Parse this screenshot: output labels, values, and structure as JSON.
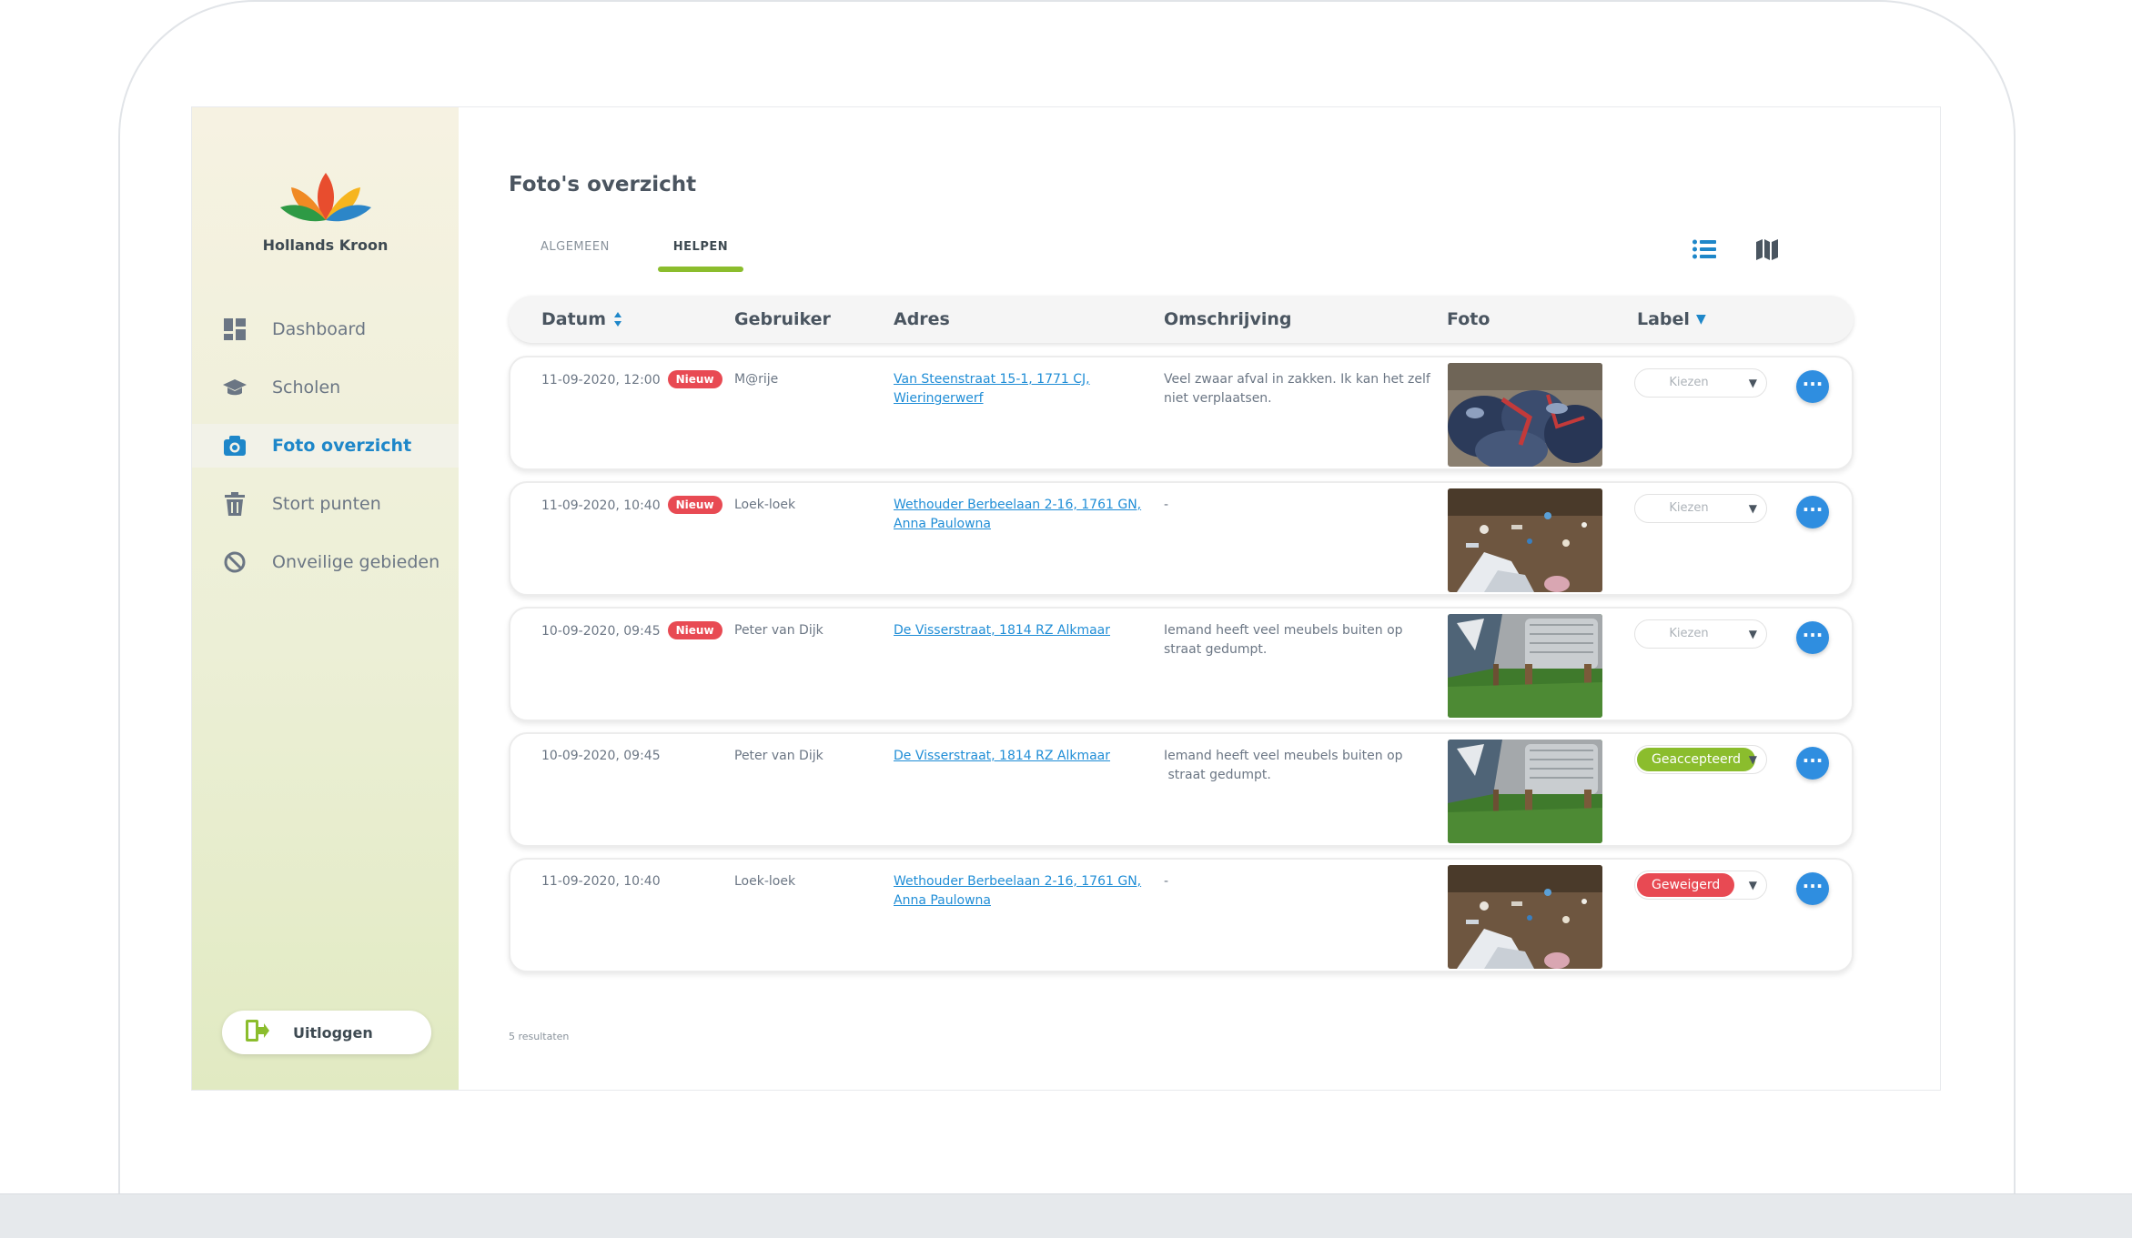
{
  "brand": {
    "name": "Hollands Kroon"
  },
  "sidebar": {
    "items": [
      {
        "label": "Dashboard",
        "icon": "dashboard-icon",
        "active": false
      },
      {
        "label": "Scholen",
        "icon": "graduation-cap-icon",
        "active": false
      },
      {
        "label": "Foto overzicht",
        "icon": "camera-icon",
        "active": true
      },
      {
        "label": "Stort punten",
        "icon": "trash-icon",
        "active": false
      },
      {
        "label": "Onveilige gebieden",
        "icon": "prohibited-icon",
        "active": false
      }
    ],
    "logout_label": "Uitloggen"
  },
  "page": {
    "title": "Foto's overzicht"
  },
  "tabs": [
    {
      "label": "ALGEMEEN",
      "active": false
    },
    {
      "label": "HELPEN",
      "active": true
    }
  ],
  "view_toggle": {
    "list_icon": "list-view-icon",
    "map_icon": "map-view-icon",
    "active": "list"
  },
  "table": {
    "headers": {
      "datum": "Datum",
      "gebruiker": "Gebruiker",
      "adres": "Adres",
      "omschrijving": "Omschrijving",
      "foto": "Foto",
      "label": "Label"
    },
    "rows": [
      {
        "date": "11-09-2020, 12:00",
        "badge": "Nieuw",
        "user": "M@rije",
        "address_line1": "Van Steenstraat 15-1, 1771 CJ,",
        "address_line2": "Wieringerwerf",
        "desc_line1": "Veel zwaar afval in zakken. Ik kan het zelf",
        "desc_line2": "niet verplaatsen.",
        "label": "Kiezen"
      },
      {
        "date": "11-09-2020, 10:40",
        "badge": "Nieuw",
        "user": "Loek-loek",
        "address_line1": "Wethouder Berbeelaan 2-16, 1761 GN,",
        "address_line2": "Anna Paulowna",
        "desc_line1": "-",
        "desc_line2": "",
        "label": "Kiezen"
      },
      {
        "date": "10-09-2020, 09:45",
        "badge": "Nieuw",
        "user": "Peter van Dijk",
        "address_line1": "De Visserstraat, 1814 RZ Alkmaar",
        "address_line2": "",
        "desc_line1": "Iemand heeft veel meubels buiten op",
        "desc_line2": "straat gedumpt.",
        "label": "Kiezen"
      },
      {
        "date": "10-09-2020, 09:45",
        "badge": "",
        "user": "Peter van Dijk",
        "address_line1": "De Visserstraat, 1814 RZ Alkmaar",
        "address_line2": "",
        "desc_line1": "Iemand heeft veel meubels buiten op",
        "desc_line2": " straat gedumpt.",
        "label": "Geaccepteerd"
      },
      {
        "date": "11-09-2020, 10:40",
        "badge": "",
        "user": "Loek-loek",
        "address_line1": "Wethouder Berbeelaan 2-16, 1761 GN,",
        "address_line2": "Anna Paulowna",
        "desc_line1": "-",
        "desc_line2": "",
        "label": "Geweigerd"
      }
    ],
    "more_label": "···"
  },
  "results_text": "5 resultaten",
  "colors": {
    "accent_blue": "#1e87c9",
    "tab_underline": "#8bbd2d",
    "badge_new": "#e84a53",
    "label_accepted": "#8bbd2d",
    "label_rejected": "#e84a53"
  }
}
